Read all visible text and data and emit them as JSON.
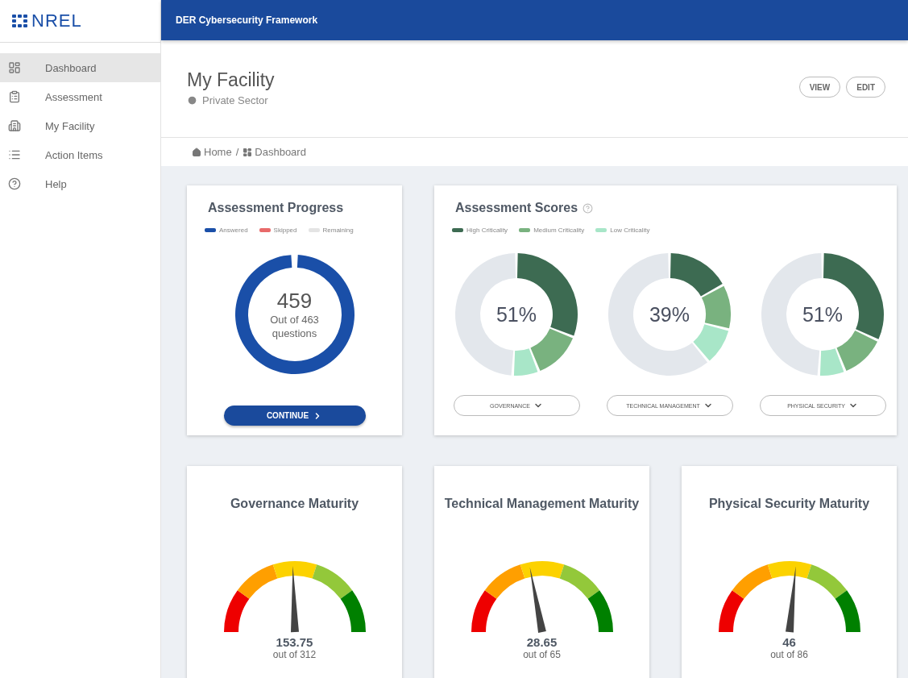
{
  "logo": {
    "text": "NREL"
  },
  "sidebar": {
    "items": [
      {
        "label": "Dashboard",
        "kind": "dashboard",
        "selected": true
      },
      {
        "label": "Assessment",
        "kind": "clipboard",
        "selected": false
      },
      {
        "label": "My Facility",
        "kind": "building",
        "selected": false
      },
      {
        "label": "Action Items",
        "kind": "list",
        "selected": false
      },
      {
        "label": "Help",
        "kind": "help",
        "selected": false
      }
    ]
  },
  "top_bar": {
    "title": "DER Cybersecurity Framework"
  },
  "header": {
    "title": "My Facility",
    "subtitle": "Private Sector",
    "buttons": [
      "VIEW",
      "EDIT"
    ]
  },
  "breadcrumb": {
    "separator": "/",
    "items": [
      {
        "label": "Home",
        "kind": "home"
      },
      {
        "label": "Dashboard",
        "kind": "dashboard"
      }
    ]
  },
  "progress": {
    "title": "Assessment Progress",
    "legend": [
      {
        "label": "Answered",
        "color": "#1a4fa8"
      },
      {
        "label": "Skipped",
        "color": "#e86a6a"
      },
      {
        "label": "Remaining",
        "color": "#e4e4e4"
      }
    ],
    "answered": "459",
    "caption": "Out of 463 questions",
    "button": "CONTINUE"
  },
  "scores": {
    "title": "Assessment Scores",
    "legend": [
      {
        "label": "High Criticality",
        "color": "#3d6b52"
      },
      {
        "label": "Medium Criticality",
        "color": "#79b27f"
      },
      {
        "label": "Low Criticality",
        "color": "#a8e6c8"
      }
    ],
    "donuts": [
      {
        "value": "51%",
        "button": "GOVERNANCE"
      },
      {
        "value": "39%",
        "button": "TECHNICAL MANAGEMENT"
      },
      {
        "value": "51%",
        "button": "PHYSICAL SECURITY"
      }
    ]
  },
  "maturity": [
    {
      "title": "Governance Maturity",
      "value": "153.75",
      "total": "out of 312"
    },
    {
      "title": "Technical Management Maturity",
      "value": "28.65",
      "total": "out of 65"
    },
    {
      "title": "Physical Security Maturity",
      "value": "46",
      "total": "out of 86"
    }
  ]
}
